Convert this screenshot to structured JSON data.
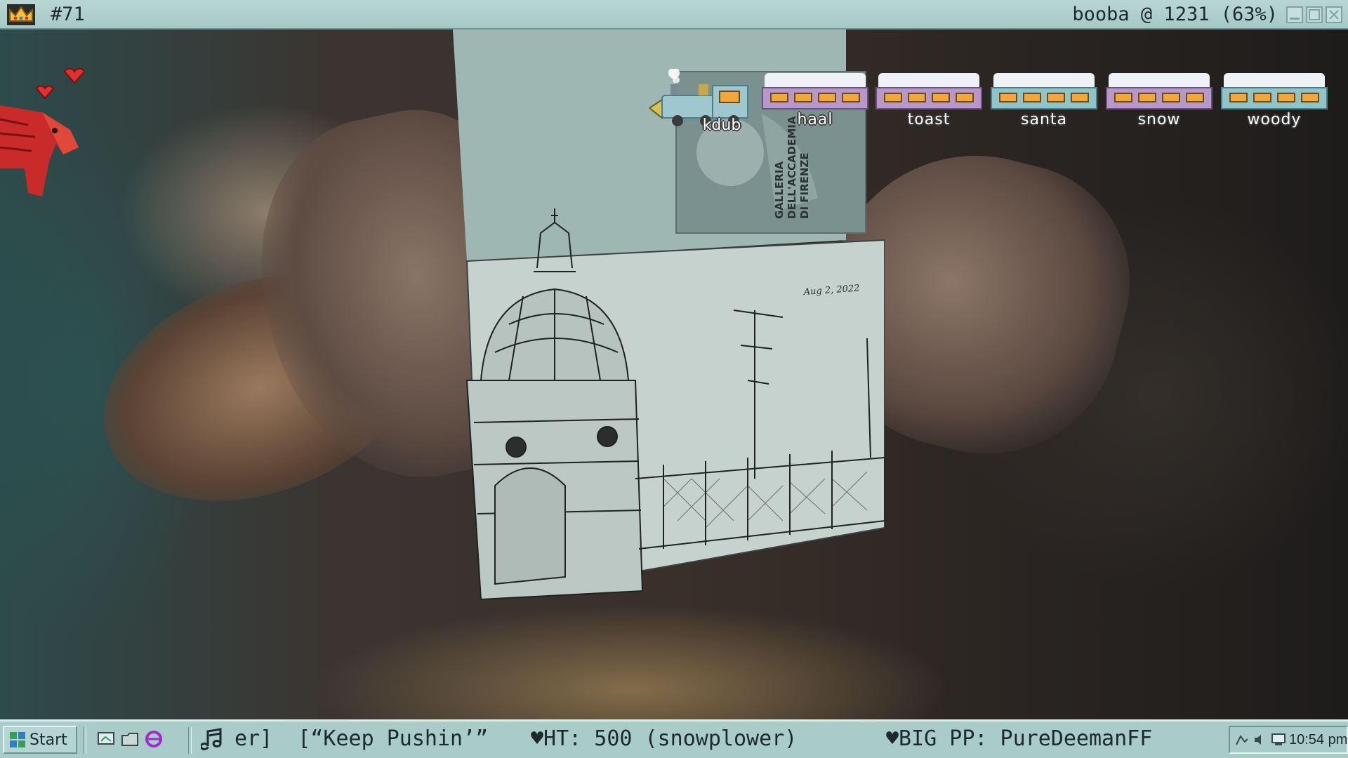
{
  "window": {
    "counter": "#71",
    "title": "booba @ 1231 (63%)"
  },
  "notebook": {
    "ticket_text": [
      "GALLERIA",
      "DELL'ACCADEMIA",
      "DI FIRENZE"
    ],
    "date": "Aug 2, 2022"
  },
  "train": {
    "engine_label": "kdub",
    "cars": [
      {
        "label": "haal",
        "color": "#b898c9"
      },
      {
        "label": "toast",
        "color": "#b898c9"
      },
      {
        "label": "santa",
        "color": "#8fc4c8"
      },
      {
        "label": "snow",
        "color": "#b898c9"
      },
      {
        "label": "woody",
        "color": "#8fc4c8"
      }
    ]
  },
  "taskbar": {
    "start_label": "Start",
    "now_playing": "er]  [“Keep Pushin’”",
    "hype_train": "♥HT: 500 (snowplower)",
    "big_pp": "♥BIG PP: PureDeemanFF",
    "clock": "10:54 pm",
    "quicklaunch_icons": [
      "desktop-icon",
      "folder-icon",
      "browser-icon"
    ],
    "music_icon": "music-note-icon"
  },
  "overlay": {
    "mascot": "red-dragon-icon",
    "hearts": 2
  },
  "colors": {
    "titlebar": "#a6c8c5",
    "taskbar": "#a9ccc9",
    "car_purple": "#b898c9",
    "car_teal": "#8fc4c8",
    "window_light": "#f2a73a"
  }
}
